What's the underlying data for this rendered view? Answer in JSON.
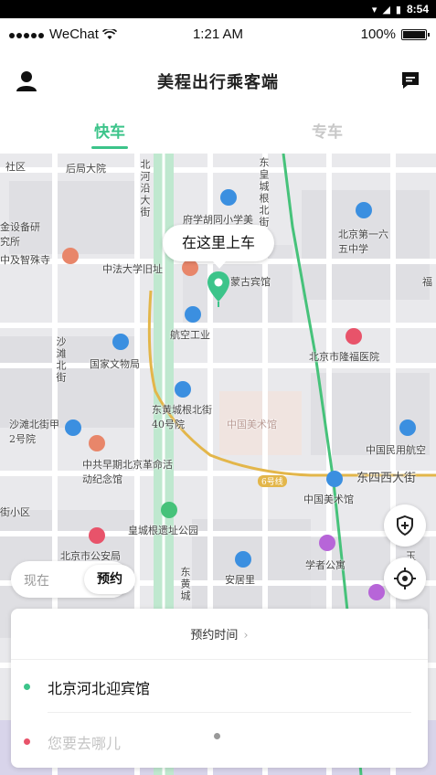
{
  "android_status": {
    "time": "8:54"
  },
  "ios_status": {
    "carrier": "WeChat",
    "time": "1:21 AM",
    "battery": "100%"
  },
  "header": {
    "title": "美程出行乘客端",
    "user_icon": "user-icon",
    "message_icon": "message-icon"
  },
  "tabs": [
    {
      "label": "快车",
      "active": true
    },
    {
      "label": "专车",
      "active": false
    }
  ],
  "colors": {
    "accent": "#3cc48a",
    "pickup_dot": "#3cc48a",
    "dropoff_dot": "#e8536a",
    "route_green": "#46c27a",
    "route_yellow": "#e3b64a"
  },
  "map": {
    "labels": [
      "社区",
      "后局大院",
      "北河沿大街",
      "东皇城根北街",
      "府学胡同小学美",
      "北京第一六五中学",
      "金设备研究所",
      "中及智殊寺",
      "中法大学旧址",
      "蒙古宾馆",
      "福",
      "航空工业",
      "国家文物局",
      "北京市隆福医院",
      "沙滩北街",
      "东黄城根北街40号院",
      "中国美术馆",
      "沙滩北街甲2号院",
      "中共早期北京革命活动纪念馆",
      "中国民用航空",
      "东四西大街",
      "中国美术馆",
      "街小区",
      "皇城根遗址公园",
      "北京市公安局",
      "学者公寓",
      "玉",
      "安居里",
      "东黄城",
      "6号线"
    ],
    "callout": "在这里上车"
  },
  "controls": {
    "mode_now": "现在",
    "mode_book": "预约",
    "safety_icon": "shield-plus-icon",
    "locate_icon": "crosshair-icon"
  },
  "trip": {
    "booking_time": "预约时间",
    "pickup": "北京河北迎宾馆",
    "dropoff_placeholder": "您要去哪儿"
  }
}
